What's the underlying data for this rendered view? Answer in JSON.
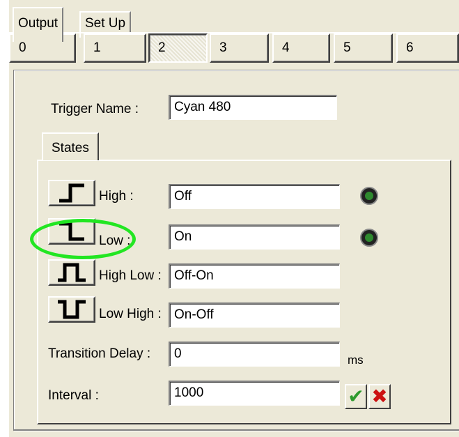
{
  "tabs": {
    "output": "Output",
    "setup": "Set Up"
  },
  "channels": [
    "0",
    "1",
    "2",
    "3",
    "4",
    "5",
    "6"
  ],
  "selected_channel": "2",
  "trigger": {
    "label": "Trigger Name :",
    "value": "Cyan 480"
  },
  "states_tab": "States",
  "states": [
    {
      "label": "High :",
      "value": "Off",
      "icon": "rising-edge-icon",
      "led": true
    },
    {
      "label": "Low :",
      "value": "On",
      "icon": "falling-edge-icon",
      "led": true
    },
    {
      "label": "High Low :",
      "value": "Off-On",
      "icon": "high-pulse-icon",
      "led": false
    },
    {
      "label": "Low High :",
      "value": "On-Off",
      "icon": "low-pulse-icon",
      "led": false
    }
  ],
  "transition_delay": {
    "label": "Transition Delay :",
    "value": "0",
    "unit": "ms"
  },
  "interval": {
    "label": "Interval :",
    "value": "1000"
  },
  "colors": {
    "highlight": "#22e622",
    "accept": "#2e9a2e",
    "cancel": "#cc1111"
  }
}
